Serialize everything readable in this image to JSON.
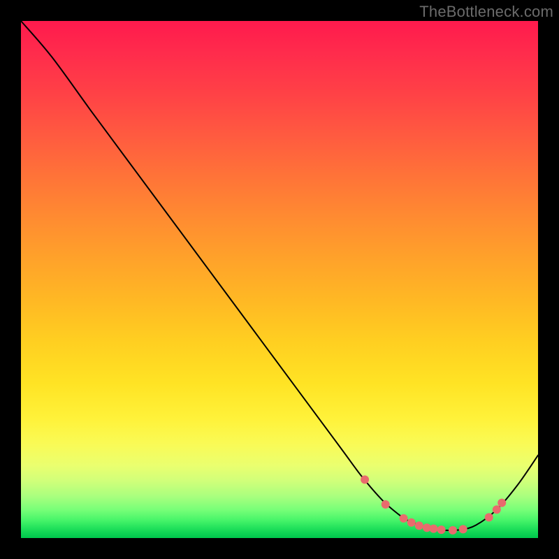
{
  "watermark": "TheBottleneck.com",
  "chart_data": {
    "type": "line",
    "title": "",
    "xlabel": "",
    "ylabel": "",
    "xlim": [
      0,
      100
    ],
    "ylim": [
      0,
      100
    ],
    "grid": false,
    "legend": false,
    "background_gradient": {
      "top": "#ff1a4d",
      "mid": "#ffe324",
      "bottom": "#00c74c"
    },
    "series": [
      {
        "name": "curve",
        "color": "#000000",
        "stroke_width": 2,
        "x": [
          0,
          6,
          14,
          24,
          34,
          44,
          54,
          62,
          66,
          70,
          73,
          75,
          78,
          80,
          82,
          85,
          88,
          92,
          96,
          100
        ],
        "y": [
          100,
          93,
          82,
          68.5,
          55,
          41.5,
          28,
          17.2,
          11.8,
          7.2,
          4.6,
          3.3,
          2.2,
          1.7,
          1.5,
          1.6,
          2.5,
          5.5,
          10.2,
          16
        ]
      }
    ],
    "markers": {
      "name": "highlight-dots",
      "color": "#e96b6d",
      "radius": 6,
      "points": [
        {
          "x": 66.5,
          "y": 11.3
        },
        {
          "x": 70.5,
          "y": 6.5
        },
        {
          "x": 74.0,
          "y": 3.8
        },
        {
          "x": 75.5,
          "y": 3.0
        },
        {
          "x": 77.0,
          "y": 2.4
        },
        {
          "x": 78.5,
          "y": 2.0
        },
        {
          "x": 79.8,
          "y": 1.8
        },
        {
          "x": 81.3,
          "y": 1.6
        },
        {
          "x": 83.5,
          "y": 1.5
        },
        {
          "x": 85.5,
          "y": 1.7
        },
        {
          "x": 90.5,
          "y": 4.0
        },
        {
          "x": 92.0,
          "y": 5.5
        },
        {
          "x": 93.0,
          "y": 6.8
        }
      ]
    }
  }
}
